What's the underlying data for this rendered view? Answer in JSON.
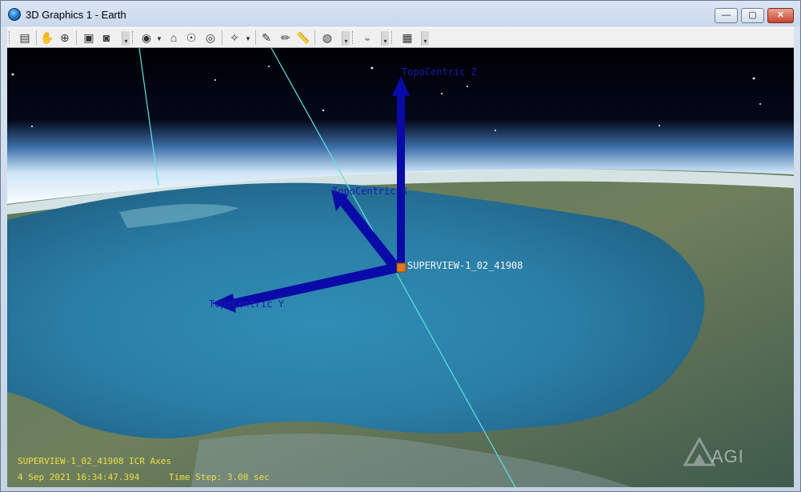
{
  "window": {
    "title": "3D Graphics 1 - Earth",
    "buttons": {
      "minimize": "—",
      "maximize": "▢",
      "close": "✕"
    }
  },
  "toolbar": {
    "buttons": [
      {
        "name": "properties-button",
        "icon": "notepad-icon",
        "glyph": "▤"
      },
      {
        "name": "pan-button",
        "icon": "hand-icon",
        "glyph": "✋"
      },
      {
        "name": "zoom-button",
        "icon": "magnifier-icon",
        "glyph": "⊕"
      },
      {
        "name": "snapshot-button",
        "icon": "film-camera-icon",
        "glyph": "▣"
      },
      {
        "name": "record-button",
        "icon": "camera-icon",
        "glyph": "◙"
      },
      {
        "name": "view-from-to-button",
        "icon": "eye-icon",
        "glyph": "◉"
      },
      {
        "name": "home-view-button",
        "icon": "home-icon",
        "glyph": "⌂"
      },
      {
        "name": "orient-north-button",
        "icon": "eye-up-icon",
        "glyph": "☉"
      },
      {
        "name": "orient-top-button",
        "icon": "eye-down-icon",
        "glyph": "◎"
      },
      {
        "name": "view-object-button",
        "icon": "satellite-eye-icon",
        "glyph": "✧"
      },
      {
        "name": "pencil-button",
        "icon": "pencil-icon",
        "glyph": "✎"
      },
      {
        "name": "eraser-button",
        "icon": "red-pen-icon",
        "glyph": "✏"
      },
      {
        "name": "measure-button",
        "icon": "ruler-icon",
        "glyph": "📏"
      },
      {
        "name": "globe-button",
        "icon": "globe-icon",
        "glyph": "◍"
      },
      {
        "name": "disk-button",
        "icon": "disk-icon",
        "glyph": "◒"
      },
      {
        "name": "window-button",
        "icon": "window-globe-icon",
        "glyph": "▦"
      }
    ]
  },
  "scene": {
    "axis_labels": {
      "z": "TopoCentric Z",
      "x": "TopoCentric X",
      "y": "TopoCentric Y"
    },
    "satellite_label": "SUPERVIEW-1_02_41908",
    "colors": {
      "axis_blue": "#0a0aa8",
      "orbit_line": "#5fe3e3",
      "satellite": "#e07a1a",
      "ocean": "#2a7fa3",
      "atmosphere": "#a8d4f2"
    }
  },
  "hud": {
    "axes_line": "SUPERVIEW-1_02_41908 ICR Axes",
    "time_line": "4 Sep 2021 16:34:47.394",
    "time_step": "Time Step: 3.00 sec"
  },
  "watermark": {
    "text": "AGI"
  }
}
